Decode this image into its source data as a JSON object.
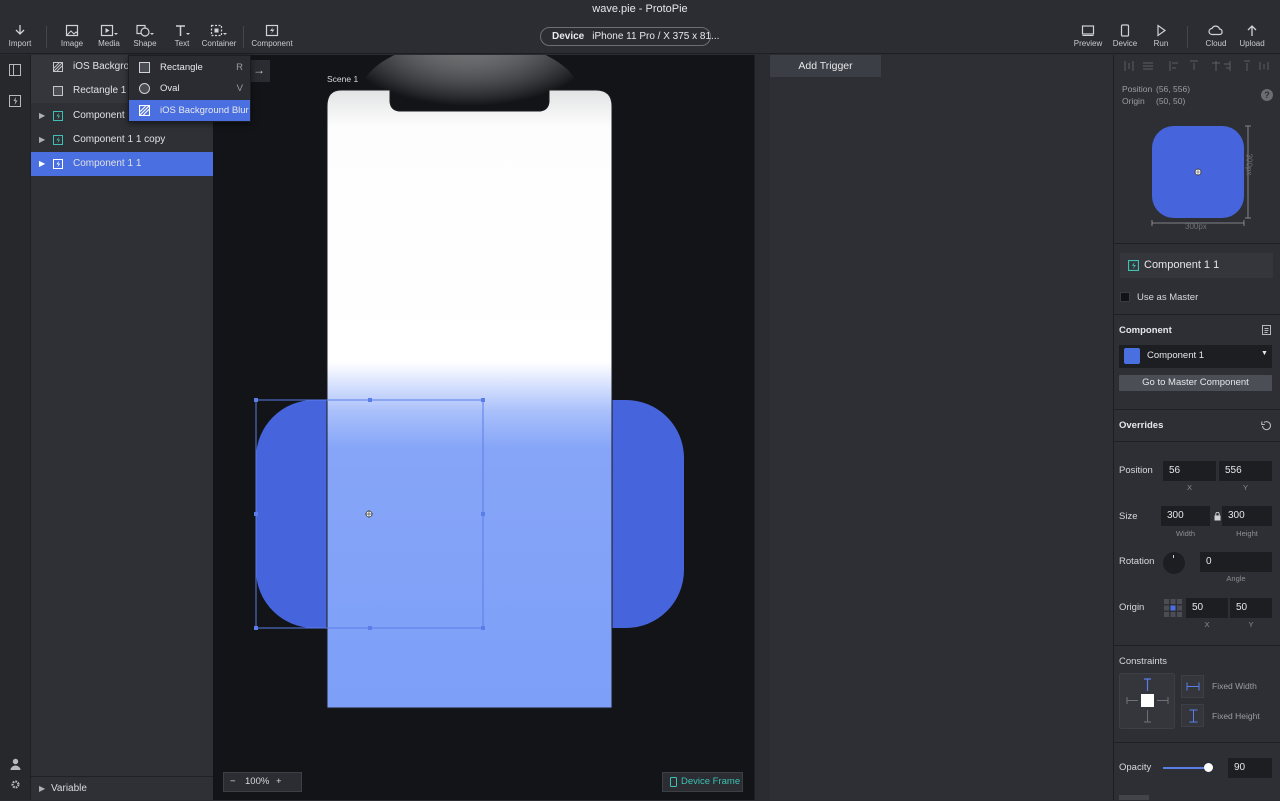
{
  "window": {
    "title": "wave.pie - ProtoPie"
  },
  "toolbar": {
    "left": [
      {
        "label": "Import",
        "icon": "import-icon"
      },
      {
        "label": "Image",
        "icon": "image-icon"
      },
      {
        "label": "Media",
        "icon": "media-icon"
      },
      {
        "label": "Shape",
        "icon": "shape-icon"
      },
      {
        "label": "Text",
        "icon": "text-icon"
      },
      {
        "label": "Container",
        "icon": "container-icon"
      },
      {
        "label": "Component",
        "icon": "component-icon"
      }
    ],
    "device": {
      "label": "Device",
      "value": "iPhone 11 Pro / X  375 x 81..."
    },
    "right": [
      {
        "label": "Preview",
        "icon": "preview-icon"
      },
      {
        "label": "Device",
        "icon": "device-icon"
      },
      {
        "label": "Run",
        "icon": "run-icon"
      },
      {
        "label": "Cloud",
        "icon": "cloud-icon"
      },
      {
        "label": "Upload",
        "icon": "upload-icon"
      }
    ]
  },
  "layers": {
    "items": [
      {
        "label": "iOS Backgrou",
        "icon": "blur-icon"
      },
      {
        "label": "Rectangle 1",
        "icon": "rectangle-icon"
      },
      {
        "label": "Component 1",
        "icon": "component-icon"
      },
      {
        "label": "Component 1 1 copy",
        "icon": "component-icon"
      },
      {
        "label": "Component 1 1",
        "icon": "component-icon",
        "selected": true
      }
    ],
    "variable_label": "Variable"
  },
  "shape_menu": {
    "items": [
      {
        "label": "Rectangle",
        "shortcut": "R"
      },
      {
        "label": "Oval",
        "shortcut": "V"
      },
      {
        "label": "iOS Background Blur",
        "shortcut": ""
      }
    ]
  },
  "canvas": {
    "scene_label": "Scene 1",
    "zoom": "100%",
    "zoom_minus": "−",
    "zoom_plus": "+",
    "device_frame_label": "Device Frame",
    "accent": "#4a6fe0"
  },
  "triggers": {
    "add_label": "Add Trigger"
  },
  "properties": {
    "position_info": "Position",
    "position_value": "(56, 556)",
    "origin_info": "Origin",
    "origin_value": "(50, 50)",
    "help": "?",
    "width_dim": "300px",
    "height_dim": "300px",
    "component_name": "Component 1 1",
    "use_as_master": "Use as Master",
    "component_section": "Component",
    "component_select": "Component 1",
    "go_master_button": "Go to Master Component",
    "overrides": "Overrides",
    "position_label": "Position",
    "pos_x": "56",
    "pos_y": "556",
    "x_sub": "X",
    "y_sub": "Y",
    "size_label": "Size",
    "width": "300",
    "height": "300",
    "width_sub": "Width",
    "height_sub": "Height",
    "rotation_label": "Rotation",
    "angle": "0",
    "angle_sub": "Angle",
    "origin_label": "Origin",
    "origin_x": "50",
    "origin_y": "50",
    "constraints_label": "Constraints",
    "fixed_width": "Fixed Width",
    "fixed_height": "Fixed Height",
    "opacity_label": "Opacity",
    "opacity": "90",
    "opacity_fraction": 0.9
  }
}
